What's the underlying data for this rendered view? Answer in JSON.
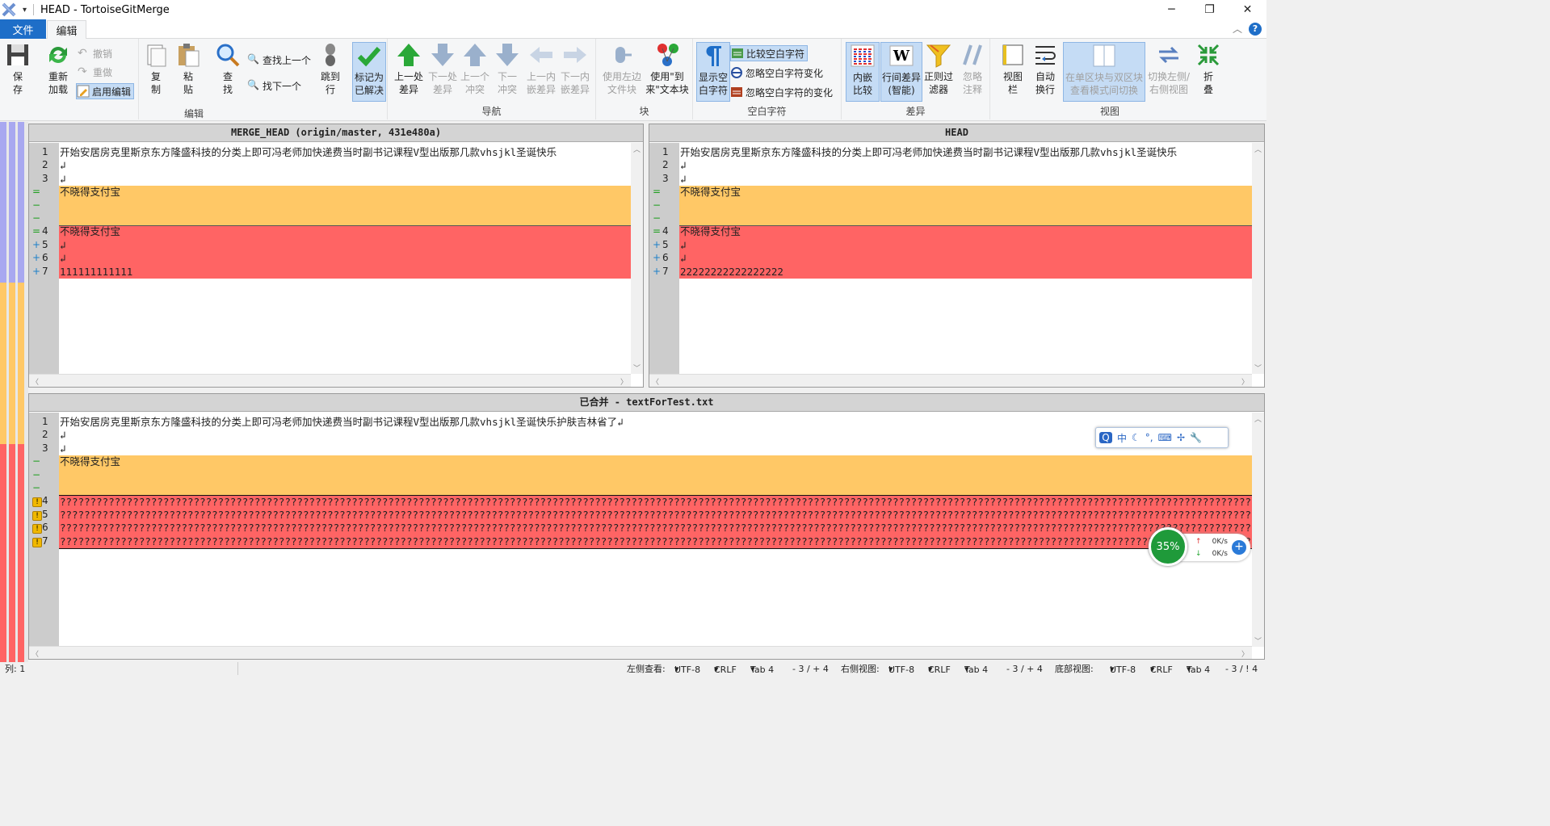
{
  "window": {
    "title": "HEAD - TortoiseGitMerge"
  },
  "menu": {
    "file": "文件",
    "edit": "编辑"
  },
  "ribbon": {
    "groups": {
      "edit": "编辑",
      "nav": "导航",
      "block": "块",
      "whitespace": "空白字符",
      "diff": "差异",
      "view": "视图"
    },
    "save": "保存",
    "reload": "重新加载",
    "undo": "撤销",
    "redo": "重做",
    "enable_edit": "启用编辑",
    "copy": "复制",
    "paste": "粘贴",
    "find": "查找",
    "find_prev": "查找上一个",
    "find_next": "找下一个",
    "goto": "跳到行",
    "mark_resolved": "标记为已解决",
    "prev_diff": "上一处差异",
    "next_diff": "下一处差异",
    "prev_conflict": "上一个冲突",
    "next_conflict": "下一冲突",
    "prev_inline": "上一内嵌差异",
    "next_inline": "下一内嵌差异",
    "use_left": "使用左边文件块",
    "use_to": "使用\"到来\"文本块",
    "show_ws": "显示空白字符",
    "compare_ws": "比较空白字符",
    "ignore_ws_change": "忽略空白字符变化",
    "ignore_all_ws": "忽略空白字符的变化",
    "inline_compare": "内嵌比较",
    "line_diff": "行间差异(智能)",
    "regex_filter": "正则过滤器",
    "ignore_comments": "忽略注释",
    "view_bar": "视图栏",
    "auto_wrap": "自动换行",
    "toggle_mode": "在单区块与双区块查看模式间切换",
    "switch_lr": "切换左侧/右侧视图",
    "fold": "折叠"
  },
  "left_pane": {
    "header": "MERGE_HEAD (origin/master, 431e480a)",
    "rows": [
      {
        "mark": "",
        "num": "1",
        "text": "开始安居房克里斯京东方隆盛科技的分类上即可冯老师加快递费当时副书记课程V型出版那几款vhsjkl圣诞快乐",
        "cls": ""
      },
      {
        "mark": "",
        "num": "2",
        "text": "↲",
        "cls": ""
      },
      {
        "mark": "",
        "num": "3",
        "text": "↲",
        "cls": ""
      },
      {
        "mark": "=",
        "num": "",
        "text": "不晓得支付宝",
        "cls": "yellow"
      },
      {
        "mark": "−",
        "num": "",
        "text": "",
        "cls": "yellow"
      },
      {
        "mark": "−",
        "num": "",
        "text": "",
        "cls": "yellow"
      },
      {
        "mark": "=",
        "num": "4",
        "text": "不晓得支付宝",
        "cls": "red"
      },
      {
        "mark": "+",
        "num": "5",
        "text": "↲",
        "cls": "red"
      },
      {
        "mark": "+",
        "num": "6",
        "text": "↲",
        "cls": "red"
      },
      {
        "mark": "+",
        "num": "7",
        "text": "111111111111",
        "cls": "red"
      }
    ]
  },
  "right_pane": {
    "header": "HEAD",
    "rows": [
      {
        "mark": "",
        "num": "1",
        "text": "开始安居房克里斯京东方隆盛科技的分类上即可冯老师加快递费当时副书记课程V型出版那几款vhsjkl圣诞快乐",
        "cls": ""
      },
      {
        "mark": "",
        "num": "2",
        "text": "↲",
        "cls": ""
      },
      {
        "mark": "",
        "num": "3",
        "text": "↲",
        "cls": ""
      },
      {
        "mark": "=",
        "num": "",
        "text": "不晓得支付宝",
        "cls": "yellow"
      },
      {
        "mark": "−",
        "num": "",
        "text": "",
        "cls": "yellow"
      },
      {
        "mark": "−",
        "num": "",
        "text": "",
        "cls": "yellow"
      },
      {
        "mark": "=",
        "num": "4",
        "text": "不晓得支付宝",
        "cls": "red"
      },
      {
        "mark": "+",
        "num": "5",
        "text": "↲",
        "cls": "red"
      },
      {
        "mark": "+",
        "num": "6",
        "text": "↲",
        "cls": "red"
      },
      {
        "mark": "+",
        "num": "7",
        "text": "22222222222222222",
        "cls": "red"
      }
    ]
  },
  "bottom_pane": {
    "header": "已合并 - textForTest.txt",
    "rows": [
      {
        "mark": "",
        "num": "1",
        "text": "开始安居房克里斯京东方隆盛科技的分类上即可冯老师加快递费当时副书记课程V型出版那几款vhsjkl圣诞快乐护肤吉林省了↲",
        "cls": ""
      },
      {
        "mark": "",
        "num": "2",
        "text": "↲",
        "cls": ""
      },
      {
        "mark": "",
        "num": "3",
        "text": "↲",
        "cls": ""
      },
      {
        "mark": "−",
        "num": "",
        "text": "不晓得支付宝",
        "cls": "yellow"
      },
      {
        "mark": "−",
        "num": "",
        "text": "",
        "cls": "yellow"
      },
      {
        "mark": "−",
        "num": "",
        "text": "",
        "cls": "yellow"
      },
      {
        "mark": "!",
        "num": "4",
        "text": "????????????????????????????????????????????????????????????????????????????????????????????????????????????????????????????????????????????????????????????????????????????????????????????????????????????????????????????????????????????????????????????????",
        "cls": "red"
      },
      {
        "mark": "!",
        "num": "5",
        "text": "????????????????????????????????????????????????????????????????????????????????????????????????????????????????????????????????????????????????????????????????????????????????????????????????????????????????????????????????????????????????????????????????",
        "cls": "red"
      },
      {
        "mark": "!",
        "num": "6",
        "text": "????????????????????????????????????????????????????????????????????????????????????????????????????????????????????????????????????????????????????????????????????????????????????????????????????????????????????????????????????????????????????????????????",
        "cls": "red"
      },
      {
        "mark": "!",
        "num": "7",
        "text": "????????????????????????????????????????????????????????????????????????????????????????????????????????????????????????????????????????????????????????????????????????????????????????????????????????????????????????????????????????????????????????????????",
        "cls": "red"
      }
    ]
  },
  "ime": {
    "label": "中"
  },
  "netmon": {
    "percent": "35%",
    "up": "0K/s",
    "down": "0K/s"
  },
  "status": {
    "col": "列: 1",
    "left_view": "左侧查看:",
    "left_enc": "UTF-8",
    "left_eol": "CRLF",
    "left_tab": "Tab 4",
    "left_diff": "- 3 / + 4",
    "right_view": "右侧视图:",
    "right_enc": "UTF-8",
    "right_eol": "CRLF",
    "right_tab": "Tab 4",
    "right_diff": "- 3 / + 4",
    "bottom_view": "底部视图:",
    "bottom_enc": "UTF-8",
    "bottom_eol": "CRLF",
    "bottom_tab": "Tab 4",
    "bottom_diff": "- 3 / ! 4"
  },
  "colors": {
    "accent": "#1e6ec8",
    "conflict_yellow": "#ffc866",
    "conflict_red": "#ff6464",
    "marker_green": "#1a9e1a",
    "marker_blue": "#1e80c8"
  }
}
